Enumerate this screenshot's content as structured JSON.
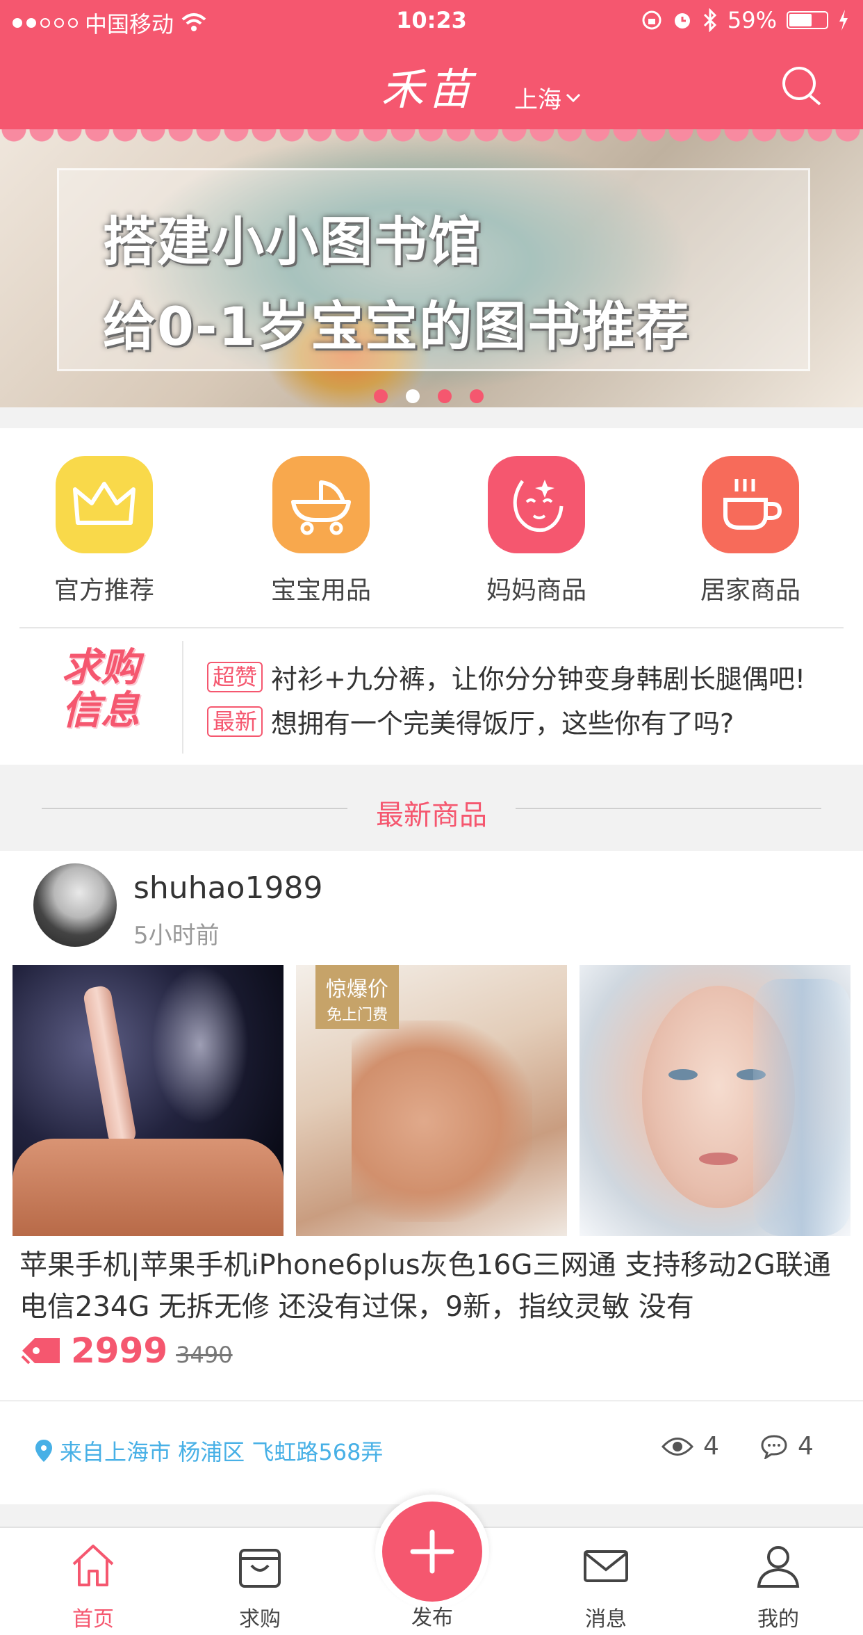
{
  "status_bar": {
    "carrier": "中国移动",
    "time": "10:23",
    "battery": "59%"
  },
  "nav": {
    "logo": "禾苗",
    "city": "上海",
    "search_icon": "search-icon"
  },
  "banner": {
    "line1": "搭建小小图书馆",
    "line2": "给0-1岁宝宝的图书推荐",
    "pages": 4,
    "active_page": 2
  },
  "categories": [
    {
      "label": "官方推荐",
      "icon": "crown-icon",
      "color": "#f9d94a"
    },
    {
      "label": "宝宝用品",
      "icon": "stroller-icon",
      "color": "#f8a84d"
    },
    {
      "label": "妈妈商品",
      "icon": "mom-face-icon",
      "color": "#f5576f"
    },
    {
      "label": "居家商品",
      "icon": "cup-icon",
      "color": "#f76b5a"
    }
  ],
  "wanted": {
    "logo_line1": "求购",
    "logo_line2": "信息",
    "items": [
      {
        "tag": "超赞",
        "text": "衬衫+九分裤，让你分分钟变身韩剧长腿偶吧!"
      },
      {
        "tag": "最新",
        "text": "想拥有一个完美得饭厅，这些你有了吗?"
      }
    ]
  },
  "section_title": "最新商品",
  "product": {
    "username": "shuhao1989",
    "time": "5小时前",
    "badge_line1": "惊爆价",
    "badge_line2": "免上门费",
    "description": "苹果手机|苹果手机iPhone6plus灰色16G三网通 支持移动2G联通电信234G 无拆无修 还没有过保，9新，指纹灵敏 没有",
    "price": "2999",
    "original_price": "3490",
    "location": "来自上海市 杨浦区 飞虹路568弄",
    "views": "4",
    "comments": "4"
  },
  "tabbar": {
    "home": "首页",
    "wanted": "求购",
    "publish": "发布",
    "messages": "消息",
    "mine": "我的"
  },
  "colors": {
    "brand": "#f5576f",
    "link": "#47b0e6"
  }
}
